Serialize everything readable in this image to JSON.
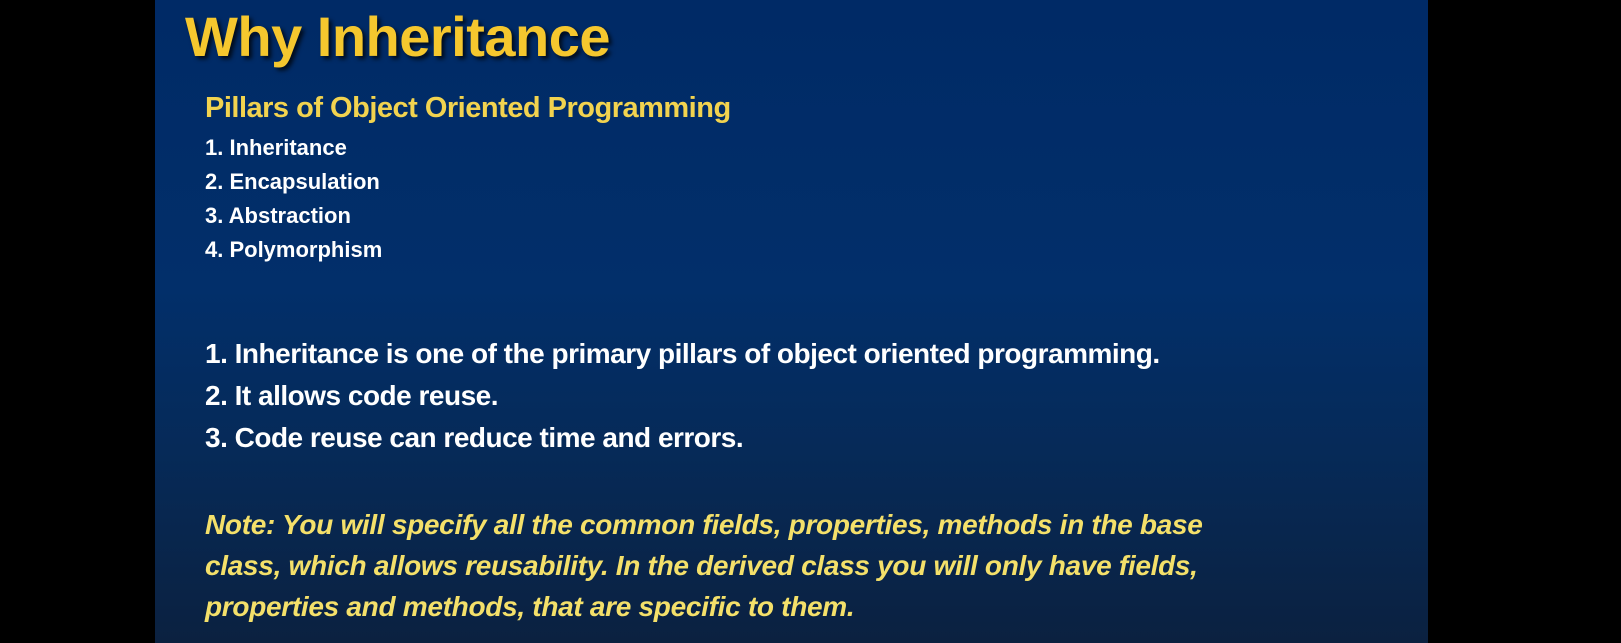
{
  "slide": {
    "title": "Why Inheritance",
    "pillars": {
      "heading": "Pillars of Object Oriented Programming",
      "items": [
        "1. Inheritance",
        "2. Encapsulation",
        "3. Abstraction",
        "4. Polymorphism"
      ]
    },
    "points": [
      "1. Inheritance is one of the primary pillars of object oriented programming.",
      "2. It allows code reuse.",
      "3. Code reuse can reduce time and errors."
    ],
    "note_lines": [
      "Note: You will specify all the common fields, properties, methods in the base",
      "class, which allows reusability. In the derived class you will only have fields,",
      "properties and methods, that are specific to them."
    ]
  },
  "colors": {
    "title": "#f5c72e",
    "heading": "#f2d34f",
    "note": "#f4e06a",
    "body_text": "#ffffff",
    "slide_background": "#002a66",
    "outer_background": "#000000"
  }
}
